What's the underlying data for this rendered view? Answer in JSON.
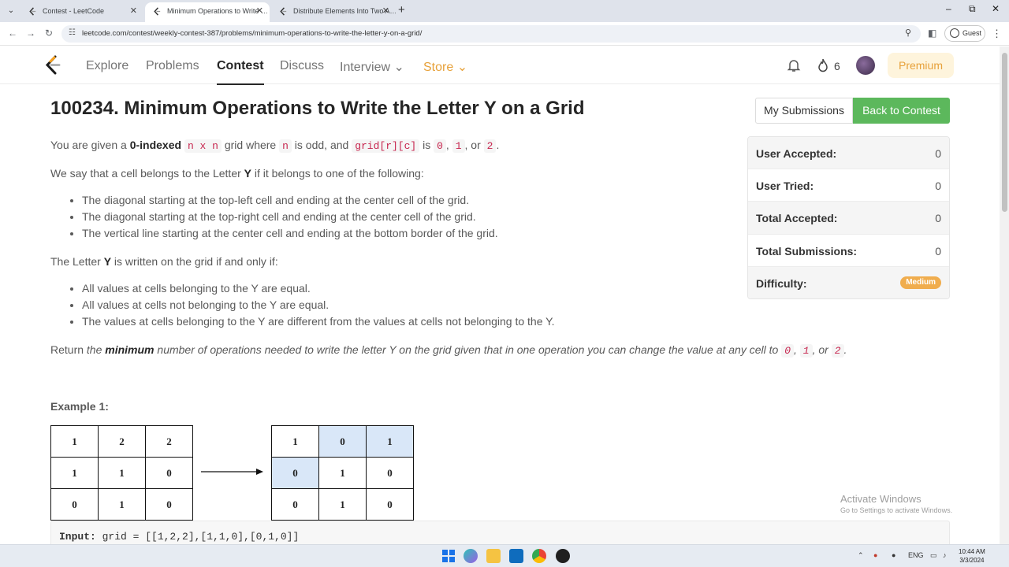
{
  "browser": {
    "tabs": [
      {
        "label": "Contest - LeetCode",
        "active": false
      },
      {
        "label": "Minimum Operations to Write …",
        "active": true
      },
      {
        "label": "Distribute Elements Into Two A…",
        "active": false
      }
    ],
    "url": "leetcode.com/contest/weekly-contest-387/problems/minimum-operations-to-write-the-letter-y-on-a-grid/",
    "profile_label": "Guest"
  },
  "nav": {
    "items": [
      {
        "label": "Explore"
      },
      {
        "label": "Problems"
      },
      {
        "label": "Contest"
      },
      {
        "label": "Discuss"
      },
      {
        "label": "Interview ⌄"
      },
      {
        "label": "Store ⌄"
      }
    ],
    "streak_count": "6",
    "premium_label": "Premium"
  },
  "problem": {
    "title": "100234. Minimum Operations to Write the Letter Y on a Grid",
    "my_submissions_label": "My Submissions",
    "back_label": "Back to Contest",
    "p1": {
      "t1": "You are given a ",
      "b1": "0-indexed",
      "c1": "n x n",
      "t2": " grid where ",
      "c2": "n",
      "t3": " is odd, and ",
      "c3": "grid[r][c]",
      "t4": " is ",
      "c4": "0",
      "t5": ", ",
      "c5": "1",
      "t6": ", or ",
      "c6": "2",
      "t7": "."
    },
    "p2": {
      "t1": "We say that a cell belongs to the Letter ",
      "b1": "Y",
      "t2": " if it belongs to one of the following:"
    },
    "list1": [
      "The diagonal starting at the top-left cell and ending at the center cell of the grid.",
      "The diagonal starting at the top-right cell and ending at the center cell of the grid.",
      "The vertical line starting at the center cell and ending at the bottom border of the grid."
    ],
    "p3": {
      "t1": "The Letter ",
      "b1": "Y",
      "t2": " is written on the grid if and only if:"
    },
    "list2": [
      "All values at cells belonging to the Y are equal.",
      "All values at cells not belonging to the Y are equal.",
      "The values at cells belonging to the Y are different from the values at cells not belonging to the Y."
    ],
    "ret": {
      "t1": "Return ",
      "t2": "the ",
      "b1": "minimum",
      "t3": " number of operations needed to write the letter Y on the grid given that in one operation you can change the value at any cell to ",
      "c1": "0",
      "t4": ", ",
      "c2": "1",
      "t5": ", or ",
      "c3": "2",
      "t6": "."
    }
  },
  "stats": [
    {
      "label": "User Accepted:",
      "value": "0"
    },
    {
      "label": "User Tried:",
      "value": "0"
    },
    {
      "label": "Total Accepted:",
      "value": "0"
    },
    {
      "label": "Total Submissions:",
      "value": "0"
    },
    {
      "label": "Difficulty:",
      "value": "Medium"
    }
  ],
  "example": {
    "heading": "Example 1:",
    "before": [
      [
        "1",
        "2",
        "2"
      ],
      [
        "1",
        "1",
        "0"
      ],
      [
        "0",
        "1",
        "0"
      ]
    ],
    "after": [
      [
        "1",
        "0",
        "1"
      ],
      [
        "0",
        "1",
        "0"
      ],
      [
        "0",
        "1",
        "0"
      ]
    ],
    "input_label": "Input:",
    "input_value": " grid = [[1,2,2],[1,1,0],[0,1,0]]"
  },
  "watermark": {
    "line1": "Activate Windows",
    "line2": "Go to Settings to activate Windows."
  },
  "taskbar": {
    "lang": "ENG",
    "time": "10:44 AM",
    "date": "3/3/2024"
  },
  "colors": {
    "accent_green": "#5cb85c",
    "store_gold": "#e7a13a",
    "y_cell": "#d9e7f8",
    "medium_badge": "#f0ad4e"
  }
}
